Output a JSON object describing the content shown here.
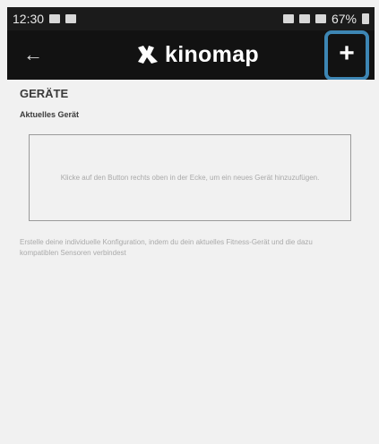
{
  "status_bar": {
    "time": "12:30",
    "battery": "67%"
  },
  "app_bar": {
    "logo_text": "kinomap",
    "back_icon": "arrow-left-icon",
    "add_label": "+",
    "add_icon": "plus-icon",
    "highlight_color": "#3d86b4"
  },
  "content": {
    "title": "GERÄTE",
    "subtitle": "Aktuelles Gerät",
    "empty_message": "Klicke auf den Button rechts oben in der Ecke, um ein neues Gerät hinzuzufügen.",
    "info_text": "Erstelle deine individuelle Konfiguration, indem du dein aktuelles Fitness-Gerät und die dazu kompatiblen Sensoren verbindest"
  }
}
